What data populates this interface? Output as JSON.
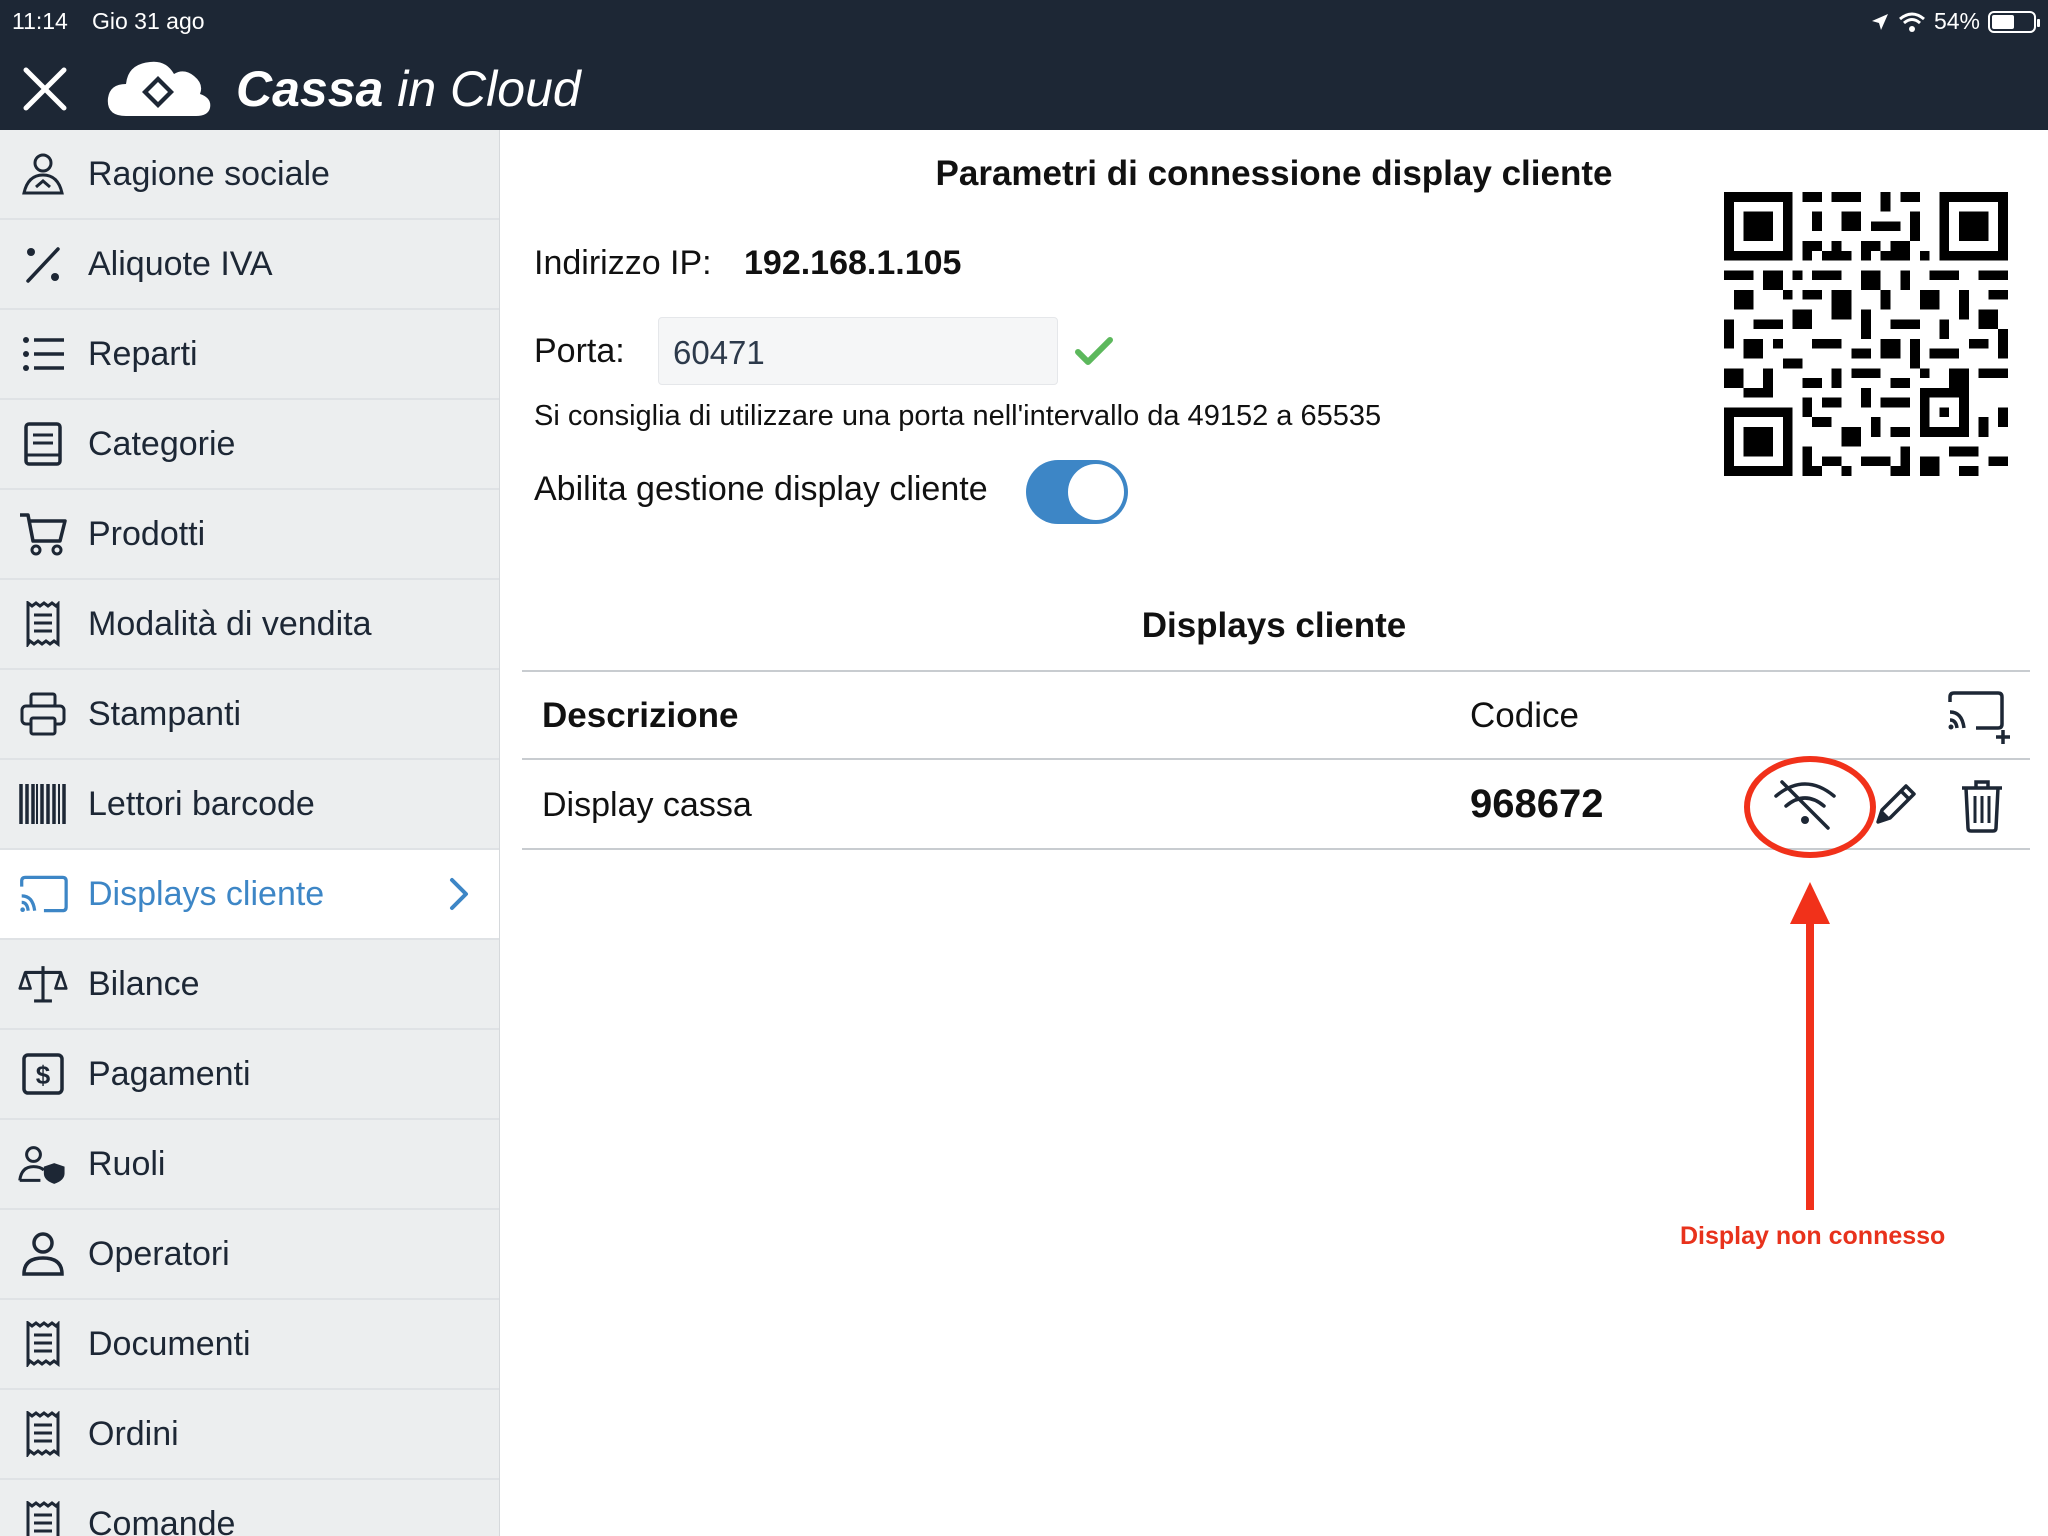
{
  "status_bar": {
    "time": "11:14",
    "date": "Gio 31 ago",
    "battery": "54%",
    "battery_level": 0.54
  },
  "header": {
    "brand_bold": "Cassa",
    "brand_light": " in Cloud"
  },
  "sidebar": {
    "items": [
      {
        "label": "Ragione sociale",
        "icon": "company-user-icon"
      },
      {
        "label": "Aliquote IVA",
        "icon": "percent-icon"
      },
      {
        "label": "Reparti",
        "icon": "list-icon"
      },
      {
        "label": "Categorie",
        "icon": "book-icon"
      },
      {
        "label": "Prodotti",
        "icon": "cart-icon"
      },
      {
        "label": "Modalità di vendita",
        "icon": "receipt-icon"
      },
      {
        "label": "Stampanti",
        "icon": "printer-icon"
      },
      {
        "label": "Lettori barcode",
        "icon": "barcode-icon"
      },
      {
        "label": "Displays cliente",
        "icon": "cast-icon",
        "active": true
      },
      {
        "label": "Bilance",
        "icon": "scale-icon"
      },
      {
        "label": "Pagamenti",
        "icon": "dollar-icon"
      },
      {
        "label": "Ruoli",
        "icon": "user-shield-icon"
      },
      {
        "label": "Operatori",
        "icon": "user-icon"
      },
      {
        "label": "Documenti",
        "icon": "receipt-icon"
      },
      {
        "label": "Ordini",
        "icon": "receipt-icon"
      },
      {
        "label": "Comande",
        "icon": "receipt-icon"
      }
    ]
  },
  "main": {
    "connection_title": "Parametri di connessione display cliente",
    "ip_label": "Indirizzo IP:",
    "ip_value": "192.168.1.105",
    "port_label": "Porta:",
    "port_value": "60471",
    "port_hint": "Si consiglia di utilizzare una porta nell'intervallo da 49152 a 65535",
    "enable_label": "Abilita gestione display cliente",
    "enable_on": true,
    "displays_title": "Displays cliente",
    "table": {
      "col_description": "Descrizione",
      "col_code": "Codice",
      "rows": [
        {
          "description": "Display cassa",
          "code": "968672",
          "status": "wifi-off-icon"
        }
      ]
    }
  },
  "annotation": {
    "text": "Display non connesso",
    "color": "#e8321c"
  },
  "colors": {
    "header_bg": "#1d2735",
    "accent": "#3d86c6",
    "sidebar_bg": "#eceeef",
    "check": "#5cb85c"
  }
}
